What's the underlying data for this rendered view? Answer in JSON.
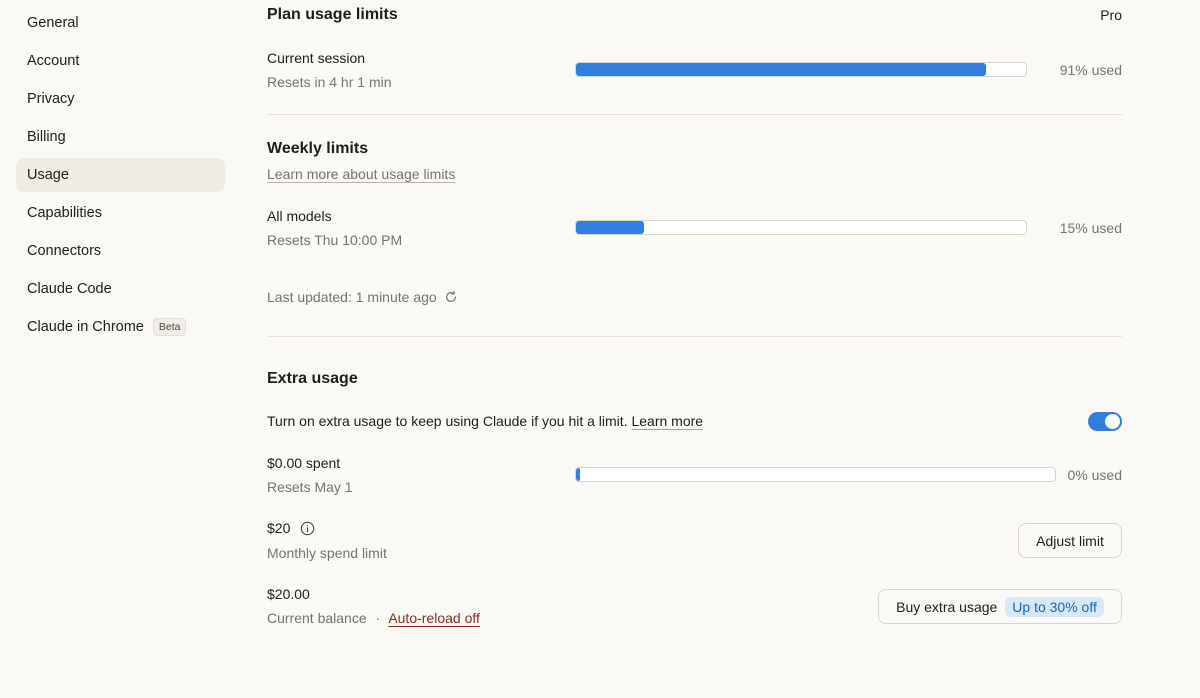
{
  "sidebar": {
    "items": [
      {
        "label": "General"
      },
      {
        "label": "Account"
      },
      {
        "label": "Privacy"
      },
      {
        "label": "Billing"
      },
      {
        "label": "Usage",
        "active": true
      },
      {
        "label": "Capabilities"
      },
      {
        "label": "Connectors"
      },
      {
        "label": "Claude Code"
      },
      {
        "label": "Claude in Chrome",
        "badge": "Beta"
      }
    ]
  },
  "plan": {
    "title": "Plan usage limits",
    "tier": "Pro",
    "session": {
      "label": "Current session",
      "reset": "Resets in 4 hr 1 min",
      "percent": 91,
      "used_text": "91% used"
    }
  },
  "weekly": {
    "title": "Weekly limits",
    "learn_more": "Learn more about usage limits",
    "all_models": {
      "label": "All models",
      "reset": "Resets Thu 10:00 PM",
      "percent": 15,
      "used_text": "15% used"
    },
    "last_updated": "Last updated: 1 minute ago"
  },
  "extra": {
    "title": "Extra usage",
    "description": "Turn on extra usage to keep using Claude if you hit a limit.",
    "learn_more": "Learn more",
    "toggle_on": true,
    "spent": {
      "label": "$0.00 spent",
      "reset": "Resets May 1",
      "percent": 0,
      "used_text": "0% used"
    },
    "limit": {
      "amount": "$20",
      "label": "Monthly spend limit",
      "button": "Adjust limit"
    },
    "balance": {
      "amount": "$20.00",
      "label": "Current balance",
      "separator": "·",
      "auto_reload": "Auto-reload off",
      "button": "Buy extra usage",
      "promo": "Up to 30% off"
    }
  },
  "colors": {
    "accent": "#2f7fde",
    "toggle": "#2f7fde",
    "link_red": "#8a2a20"
  },
  "icons": {
    "refresh": "refresh-icon",
    "info": "info-icon"
  }
}
